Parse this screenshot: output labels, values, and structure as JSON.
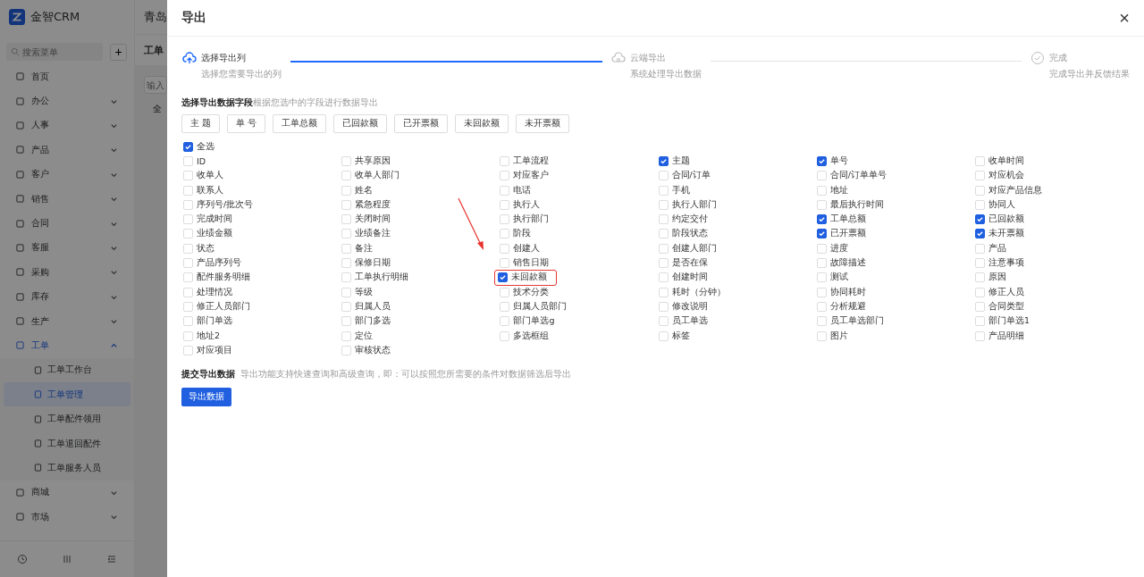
{
  "app": {
    "logo_text": "金智CRM",
    "company": "青岛",
    "search_placeholder": "搜索菜单",
    "add_label": "+"
  },
  "menu": [
    {
      "label": "首页",
      "has_children": false,
      "expanded": false
    },
    {
      "label": "办公",
      "has_children": true,
      "expanded": false
    },
    {
      "label": "人事",
      "has_children": true,
      "expanded": false
    },
    {
      "label": "产品",
      "has_children": true,
      "expanded": false
    },
    {
      "label": "客户",
      "has_children": true,
      "expanded": false
    },
    {
      "label": "销售",
      "has_children": true,
      "expanded": false
    },
    {
      "label": "合同",
      "has_children": true,
      "expanded": false
    },
    {
      "label": "客服",
      "has_children": true,
      "expanded": false
    },
    {
      "label": "采购",
      "has_children": true,
      "expanded": false
    },
    {
      "label": "库存",
      "has_children": true,
      "expanded": false
    },
    {
      "label": "生产",
      "has_children": true,
      "expanded": false
    },
    {
      "label": "工单",
      "has_children": true,
      "expanded": true,
      "children": [
        {
          "label": "工单工作台",
          "selected": false
        },
        {
          "label": "工单管理",
          "selected": true
        },
        {
          "label": "工单配件领用",
          "selected": false
        },
        {
          "label": "工单退回配件",
          "selected": false
        },
        {
          "label": "工单服务人员",
          "selected": false
        }
      ]
    },
    {
      "label": "商城",
      "has_children": true,
      "expanded": false
    },
    {
      "label": "市场",
      "has_children": true,
      "expanded": false
    }
  ],
  "page": {
    "tab_title": "工单",
    "filter_placeholder": "输入",
    "tree_root": "全"
  },
  "dialog": {
    "title": "导出",
    "close": "×",
    "steps": [
      {
        "title": "选择导出列",
        "description": "选择您需要导出的列",
        "active": true
      },
      {
        "title": "云端导出",
        "description": "系统处理导出数据",
        "active": false
      },
      {
        "title": "完成",
        "description": "完成导出并反馈结果",
        "active": false
      }
    ],
    "fields_section": {
      "title": "选择导出数据字段",
      "hint": "根据您选中的字段进行数据导出"
    },
    "quick_buttons": [
      "主 题",
      "单 号",
      "工单总额",
      "已回款额",
      "已开票额",
      "未回款额",
      "未开票额"
    ],
    "select_all": {
      "label": "全选",
      "checked": true
    },
    "fields": [
      {
        "label": "ID",
        "checked": false,
        "highlighted": false
      },
      {
        "label": "共享原因",
        "checked": false,
        "highlighted": false
      },
      {
        "label": "工单流程",
        "checked": false,
        "highlighted": false
      },
      {
        "label": "主题",
        "checked": true,
        "highlighted": false
      },
      {
        "label": "单号",
        "checked": true,
        "highlighted": false
      },
      {
        "label": "收单时间",
        "checked": false,
        "highlighted": false
      },
      {
        "label": "收单人",
        "checked": false,
        "highlighted": false
      },
      {
        "label": "收单人部门",
        "checked": false,
        "highlighted": false
      },
      {
        "label": "对应客户",
        "checked": false,
        "highlighted": false
      },
      {
        "label": "合同/订单",
        "checked": false,
        "highlighted": false
      },
      {
        "label": "合同/订单单号",
        "checked": false,
        "highlighted": false
      },
      {
        "label": "对应机会",
        "checked": false,
        "highlighted": false
      },
      {
        "label": "联系人",
        "checked": false,
        "highlighted": false
      },
      {
        "label": "姓名",
        "checked": false,
        "highlighted": false
      },
      {
        "label": "电话",
        "checked": false,
        "highlighted": false
      },
      {
        "label": "手机",
        "checked": false,
        "highlighted": false
      },
      {
        "label": "地址",
        "checked": false,
        "highlighted": false
      },
      {
        "label": "对应产品信息",
        "checked": false,
        "highlighted": false
      },
      {
        "label": "序列号/批次号",
        "checked": false,
        "highlighted": false
      },
      {
        "label": "紧急程度",
        "checked": false,
        "highlighted": false
      },
      {
        "label": "执行人",
        "checked": false,
        "highlighted": false
      },
      {
        "label": "执行人部门",
        "checked": false,
        "highlighted": false
      },
      {
        "label": "最后执行时间",
        "checked": false,
        "highlighted": false
      },
      {
        "label": "协同人",
        "checked": false,
        "highlighted": false
      },
      {
        "label": "完成时间",
        "checked": false,
        "highlighted": false
      },
      {
        "label": "关闭时间",
        "checked": false,
        "highlighted": false
      },
      {
        "label": "执行部门",
        "checked": false,
        "highlighted": false
      },
      {
        "label": "约定交付",
        "checked": false,
        "highlighted": false
      },
      {
        "label": "工单总额",
        "checked": true,
        "highlighted": false
      },
      {
        "label": "已回款额",
        "checked": true,
        "highlighted": false
      },
      {
        "label": "业绩金额",
        "checked": false,
        "highlighted": false
      },
      {
        "label": "业绩备注",
        "checked": false,
        "highlighted": false
      },
      {
        "label": "阶段",
        "checked": false,
        "highlighted": false
      },
      {
        "label": "阶段状态",
        "checked": false,
        "highlighted": false
      },
      {
        "label": "已开票额",
        "checked": true,
        "highlighted": false
      },
      {
        "label": "未开票额",
        "checked": true,
        "highlighted": false
      },
      {
        "label": "状态",
        "checked": false,
        "highlighted": false
      },
      {
        "label": "备注",
        "checked": false,
        "highlighted": false
      },
      {
        "label": "创建人",
        "checked": false,
        "highlighted": false
      },
      {
        "label": "创建人部门",
        "checked": false,
        "highlighted": false
      },
      {
        "label": "进度",
        "checked": false,
        "highlighted": false
      },
      {
        "label": "产品",
        "checked": false,
        "highlighted": false
      },
      {
        "label": "产品序列号",
        "checked": false,
        "highlighted": false
      },
      {
        "label": "保修日期",
        "checked": false,
        "highlighted": false
      },
      {
        "label": "销售日期",
        "checked": false,
        "highlighted": false
      },
      {
        "label": "是否在保",
        "checked": false,
        "highlighted": false
      },
      {
        "label": "故障描述",
        "checked": false,
        "highlighted": false
      },
      {
        "label": "注意事项",
        "checked": false,
        "highlighted": false
      },
      {
        "label": "配件服务明细",
        "checked": false,
        "highlighted": false
      },
      {
        "label": "工单执行明细",
        "checked": false,
        "highlighted": false
      },
      {
        "label": "未回款额",
        "checked": true,
        "highlighted": true
      },
      {
        "label": "创建时间",
        "checked": false,
        "highlighted": false
      },
      {
        "label": "测试",
        "checked": false,
        "highlighted": false
      },
      {
        "label": "原因",
        "checked": false,
        "highlighted": false
      },
      {
        "label": "处理情况",
        "checked": false,
        "highlighted": false
      },
      {
        "label": "等级",
        "checked": false,
        "highlighted": false
      },
      {
        "label": "技术分类",
        "checked": false,
        "highlighted": false
      },
      {
        "label": "耗时（分钟）",
        "checked": false,
        "highlighted": false
      },
      {
        "label": "协同耗时",
        "checked": false,
        "highlighted": false
      },
      {
        "label": "修正人员",
        "checked": false,
        "highlighted": false
      },
      {
        "label": "修正人员部门",
        "checked": false,
        "highlighted": false
      },
      {
        "label": "归属人员",
        "checked": false,
        "highlighted": false
      },
      {
        "label": "归属人员部门",
        "checked": false,
        "highlighted": false
      },
      {
        "label": "修改说明",
        "checked": false,
        "highlighted": false
      },
      {
        "label": "分析规避",
        "checked": false,
        "highlighted": false
      },
      {
        "label": "合同类型",
        "checked": false,
        "highlighted": false
      },
      {
        "label": "部门单选",
        "checked": false,
        "highlighted": false
      },
      {
        "label": "部门多选",
        "checked": false,
        "highlighted": false
      },
      {
        "label": "部门单选g",
        "checked": false,
        "highlighted": false
      },
      {
        "label": "员工单选",
        "checked": false,
        "highlighted": false
      },
      {
        "label": "员工单选部门",
        "checked": false,
        "highlighted": false
      },
      {
        "label": "部门单选1",
        "checked": false,
        "highlighted": false
      },
      {
        "label": "地址2",
        "checked": false,
        "highlighted": false
      },
      {
        "label": "定位",
        "checked": false,
        "highlighted": false
      },
      {
        "label": "多选框组",
        "checked": false,
        "highlighted": false
      },
      {
        "label": "标签",
        "checked": false,
        "highlighted": false
      },
      {
        "label": "图片",
        "checked": false,
        "highlighted": false
      },
      {
        "label": "产品明细",
        "checked": false,
        "highlighted": false
      },
      {
        "label": "对应项目",
        "checked": false,
        "highlighted": false
      },
      {
        "label": "审核状态",
        "checked": false,
        "highlighted": false
      }
    ],
    "submit_section": {
      "title": "提交导出数据",
      "hint": "导出功能支持快速查询和高级查询，即：可以按照您所需要的条件对数据筛选后导出"
    },
    "submit_button": "导出数据"
  }
}
